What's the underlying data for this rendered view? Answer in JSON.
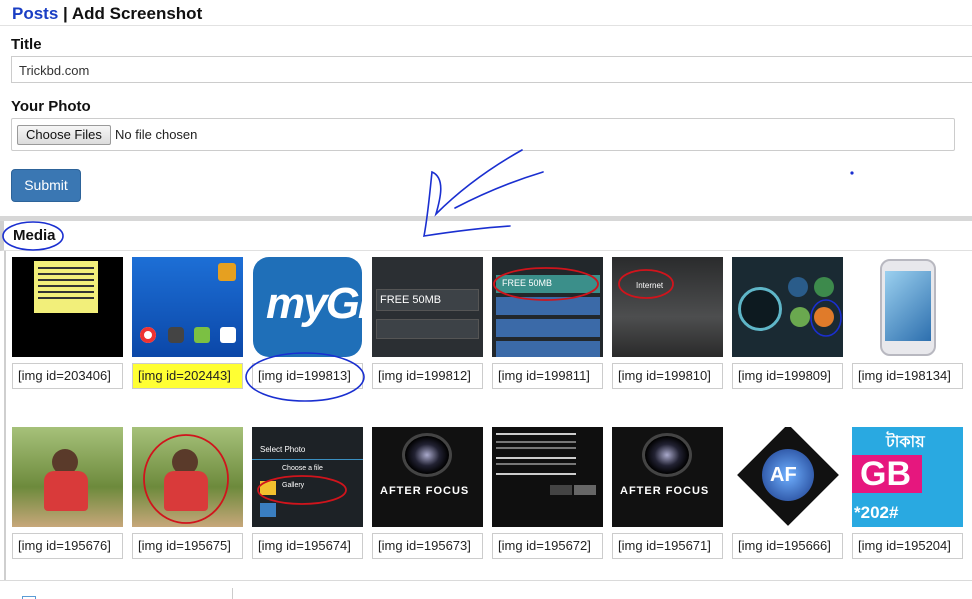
{
  "header": {
    "posts_link": "Posts",
    "separator": " | ",
    "page_title": "Add Screenshot"
  },
  "form": {
    "title_label": "Title",
    "title_value": "Trickbd.com",
    "photo_label": "Your Photo",
    "choose_button": "Choose Files",
    "file_status": "No file chosen",
    "submit_label": "Submit"
  },
  "media": {
    "heading": "Media",
    "items": [
      {
        "caption": "[img id=203406]",
        "highlighted": false
      },
      {
        "caption": "[img id=202443]",
        "highlighted": true
      },
      {
        "caption": "[img id=199813]",
        "highlighted": false
      },
      {
        "caption": "[img id=199812]",
        "highlighted": false
      },
      {
        "caption": "[img id=199811]",
        "highlighted": false
      },
      {
        "caption": "[img id=199810]",
        "highlighted": false
      },
      {
        "caption": "[img id=199809]",
        "highlighted": false
      },
      {
        "caption": "[img id=198134]",
        "highlighted": false
      },
      {
        "caption": "[img id=195676]",
        "highlighted": false
      },
      {
        "caption": "[img id=195675]",
        "highlighted": false
      },
      {
        "caption": "[img id=195674]",
        "highlighted": false
      },
      {
        "caption": "[img id=195673]",
        "highlighted": false
      },
      {
        "caption": "[img id=195672]",
        "highlighted": false
      },
      {
        "caption": "[img id=195671]",
        "highlighted": false
      },
      {
        "caption": "[img id=195666]",
        "highlighted": false
      },
      {
        "caption": "[img id=195204]",
        "highlighted": false
      }
    ]
  },
  "thumb_text": {
    "mygp": "myGP",
    "free50": "FREE 50MB",
    "afterfocus": "AFTER FOCUS",
    "af": "AF",
    "select_photo": "Select Photo",
    "choose_file": "Choose a file",
    "gallery": "Gallery",
    "internet": "Internet",
    "bd_text": "টাকায়",
    "bd_code": "*202#",
    "gb": "GB"
  },
  "colors": {
    "accent": "#1a3ec4",
    "submit": "#3a77b3",
    "highlight": "#ffff33",
    "annotation": "#1a2fd0",
    "annotation_red": "#d0141c"
  }
}
